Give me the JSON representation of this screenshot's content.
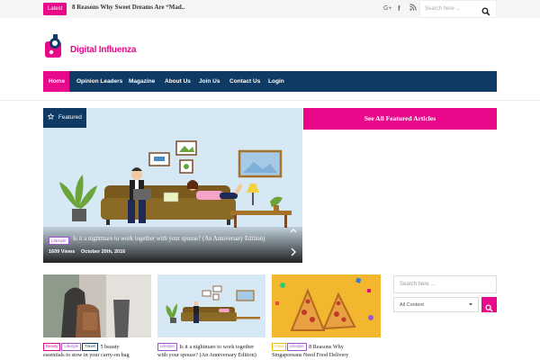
{
  "topbar": {
    "latest_label": "Latest",
    "ticker_text": "8 Reasons Why Sweet Dreams Are “Mad..",
    "social_icons": [
      "google-plus-icon",
      "facebook-icon",
      "rss-icon"
    ],
    "search_placeholder": "Search here ..."
  },
  "logo": {
    "text": "Digital Influenza"
  },
  "nav": {
    "items": [
      "Home",
      "Opinion Leaders",
      "Magazine",
      "About Us",
      "Join Us",
      "Contact Us",
      "Login"
    ],
    "active": "Home"
  },
  "featured": {
    "tag_label": "Featured",
    "category": "Lifestyle",
    "title": "Is it a nightmare to work together with your spouse? (An Anniversary Edition)",
    "views": "1609 Views",
    "date": "October 20th, 2016"
  },
  "see_all_label": "See All Featured Articles",
  "cards": [
    {
      "badges": [
        "Beauty",
        "Lifestyle",
        "Travel"
      ],
      "title_line1": "5 beauty",
      "title_line2": "essentials to stow in your carry-on bag"
    },
    {
      "badges": [
        "Lifestyle"
      ],
      "title_line1": "Is it a nightmare to work together",
      "title_line2": "with your spouse? (An Anniversary Edition)"
    },
    {
      "badges": [
        "Food",
        "Lifestyle"
      ],
      "title_line1": "8 Reasons Why",
      "title_line2": "Singaporeans Need Food Delivery"
    }
  ],
  "widget": {
    "search_placeholder": "Search here ...",
    "select_value": "All Content"
  },
  "colors": {
    "accent": "#e8098b",
    "navy": "#0e3a63",
    "lifestyle": "#9a57cc"
  }
}
